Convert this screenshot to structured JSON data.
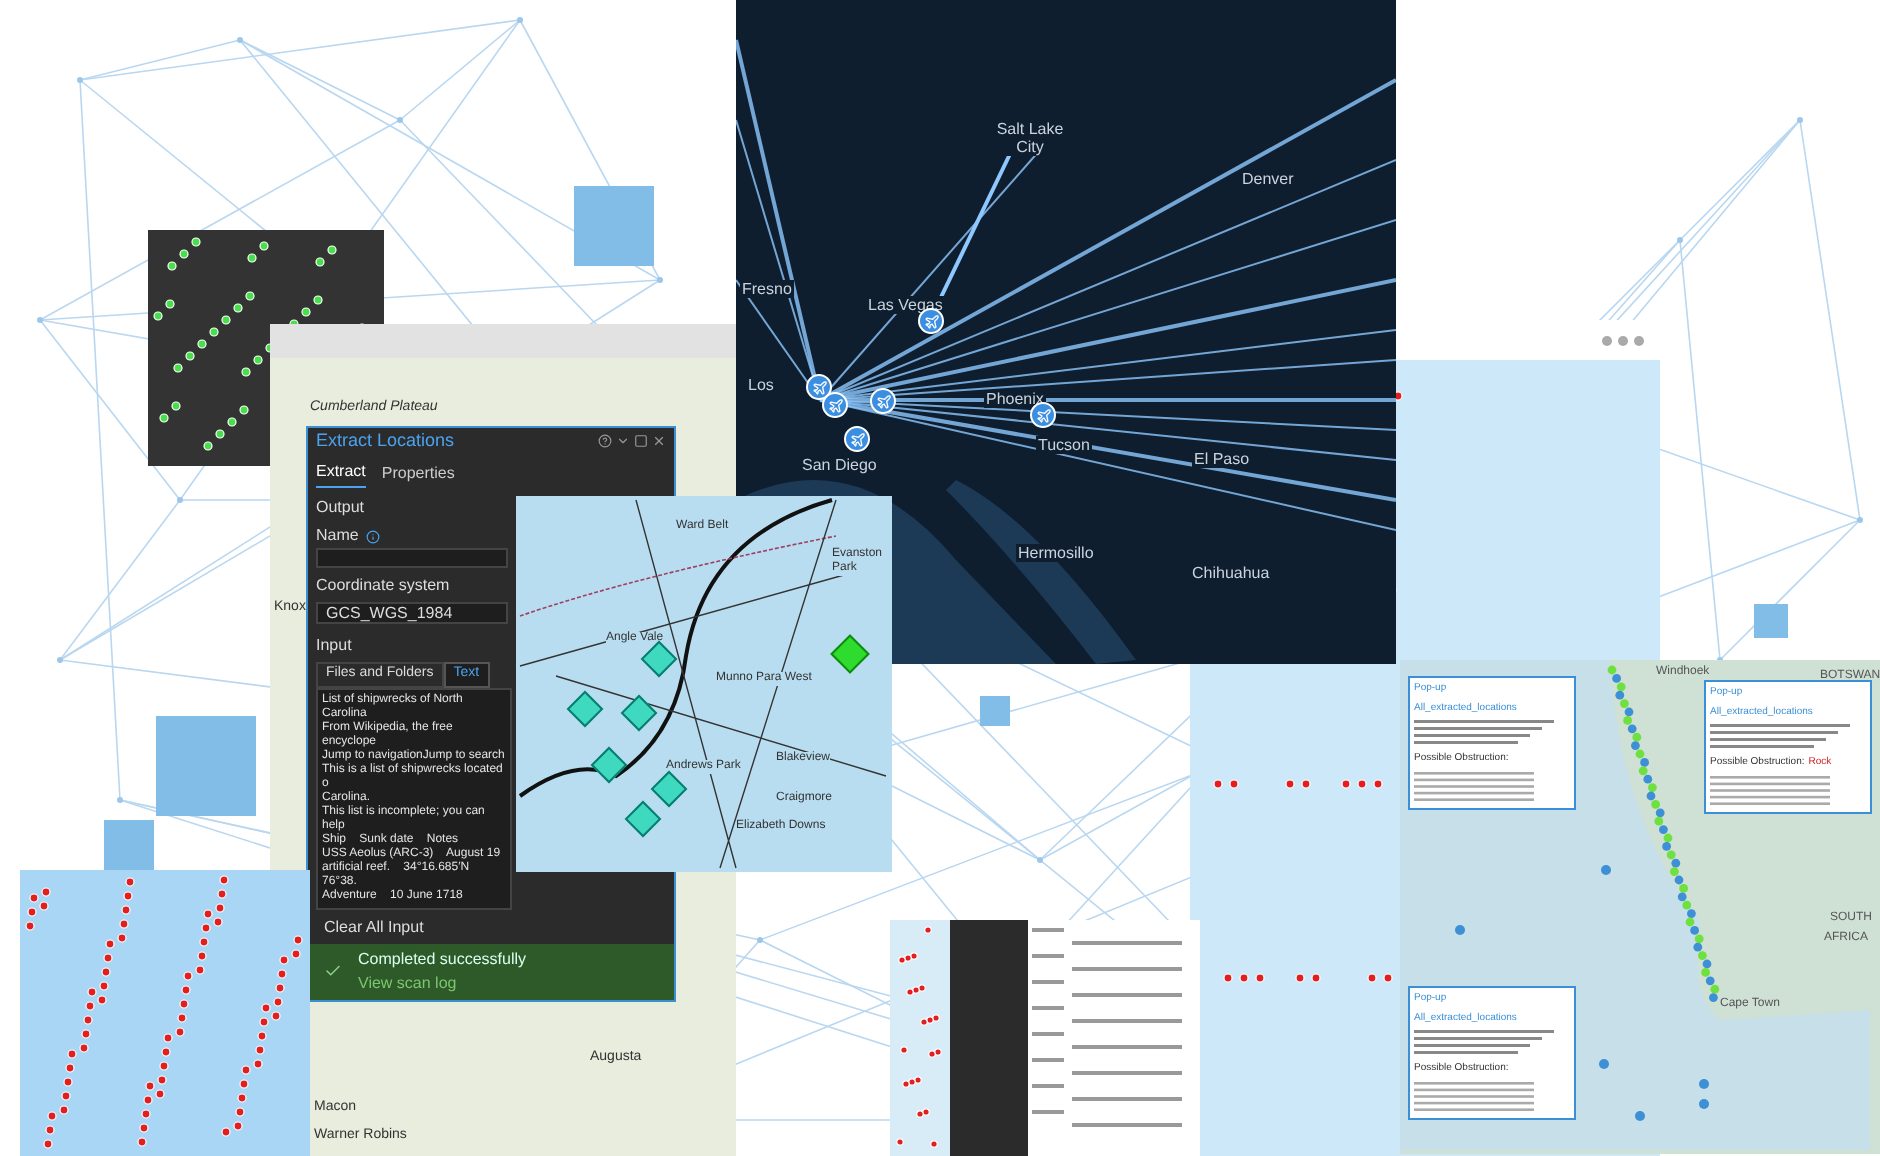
{
  "flight_map": {
    "cities": [
      "Salt Lake City",
      "Denver",
      "Fresno",
      "Las Vegas",
      "Los",
      "San Diego",
      "Phoenix",
      "Tucson",
      "El Paso",
      "Hermosillo",
      "Chihuahua"
    ]
  },
  "basemap": {
    "labels": [
      "Cumberland Plateau",
      "Knox",
      "Augusta",
      "Macon",
      "Warner Robins"
    ]
  },
  "extract_panel": {
    "title": "Extract Locations",
    "tabs": [
      {
        "label": "Extract",
        "selected": true
      },
      {
        "label": "Properties",
        "selected": false
      }
    ],
    "output_heading": "Output",
    "name_label": "Name",
    "coordinate_label": "Coordinate system",
    "coordinate_value": "GCS_WGS_1984",
    "input_heading": "Input",
    "input_tabs": [
      {
        "label": "Files and Folders",
        "selected": false
      },
      {
        "label": "Text",
        "selected": true
      }
    ],
    "text_lines": [
      "List of shipwrecks of North Carolina",
      "From Wikipedia, the free encyclope",
      "Jump to navigationJump to search",
      "This is a list of shipwrecks located o",
      "Carolina.",
      "This list is incomplete; you can help",
      "Ship    Sunk date    Notes",
      "USS Aeolus (ARC-3)    August 19",
      "artificial reef.    34°16.685′N 76°38.",
      "Adventure    10 June 1718"
    ],
    "clear_button": "Clear All Input",
    "status": {
      "message": "Completed successfully",
      "link": "View scan log"
    }
  },
  "suburb_map": {
    "labels": [
      "Ward Belt",
      "Angle Vale",
      "Evanston Park",
      "Munno Para West",
      "Blakeview",
      "Craigmore",
      "Elizabeth Downs",
      "Andrews Park"
    ]
  },
  "africa_map": {
    "labels": [
      "Windhoek",
      "BOTSWAN",
      "SOUTH",
      "AFRICA",
      "Cape Town"
    ],
    "popups": [
      {
        "title": "Pop-up",
        "layer": "All_extracted_locations",
        "obstruction_label": "Possible Obstruction:"
      },
      {
        "title": "Pop-up",
        "layer": "All_extracted_locations",
        "obstruction_label": "Possible Obstruction:",
        "obstruction": "Rock"
      },
      {
        "title": "Pop-up",
        "layer": "All_extracted_locations",
        "obstruction_label": "Possible Obstruction:"
      }
    ]
  }
}
